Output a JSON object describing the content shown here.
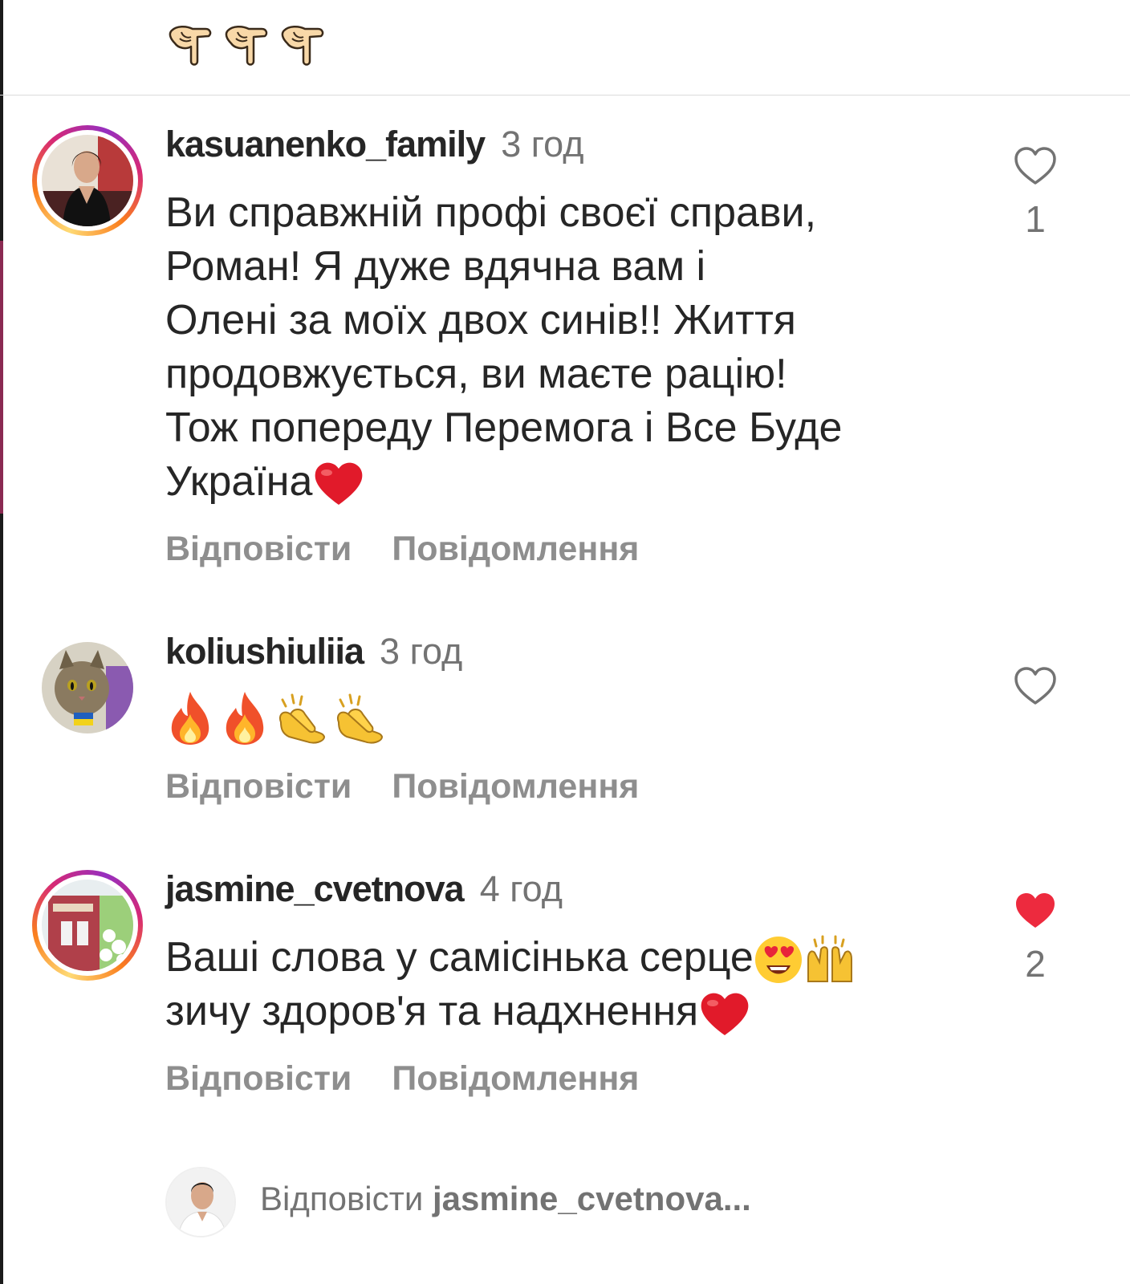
{
  "caption": {
    "emojis": [
      "point-down-icon",
      "point-down-icon",
      "point-down-icon"
    ]
  },
  "comments": [
    {
      "username": "kasuanenko_family",
      "time": "3 год",
      "lines": [
        "Ви справжній профі своєї справи,",
        "Роман! Я дуже вдячна вам  і",
        "Олені за моїх двох синів!! Життя",
        "продовжується, ви маєте рацію!",
        "Тож попереду Перемога і Все Буде",
        "Україна"
      ],
      "trailing_emoji": "red-heart-icon",
      "likes": "1",
      "liked": false,
      "reply_label": "Відповісти",
      "message_label": "Повідомлення"
    },
    {
      "username": "koliushiuliia",
      "time": "3 год",
      "emojis": [
        "fire-icon",
        "fire-icon",
        "clapping-hands-icon",
        "clapping-hands-icon"
      ],
      "likes": "",
      "liked": false,
      "reply_label": "Відповісти",
      "message_label": "Повідомлення"
    },
    {
      "username": "jasmine_cvetnova",
      "time": "4 год",
      "lines": [
        "Ваші слова у самісінька серце",
        "зичу здоров'я та надхнення"
      ],
      "line1_emojis": [
        "heart-eyes-icon",
        "raising-hands-icon"
      ],
      "trailing_emoji": "red-heart-icon",
      "likes": "2",
      "liked": true,
      "reply_label": "Відповісти",
      "message_label": "Повідомлення"
    }
  ],
  "reply_input": {
    "prefix": "Відповісти",
    "target": "jasmine_cvetnova..."
  },
  "colors": {
    "text": "#262626",
    "muted": "#8e8e8e",
    "like_active": "#ed4956",
    "divider": "#dbdbdb"
  }
}
